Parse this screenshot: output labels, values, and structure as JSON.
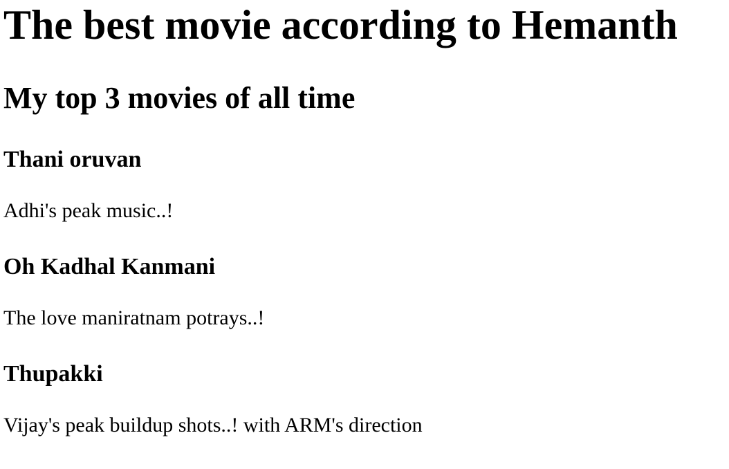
{
  "page": {
    "title": "The best movie according to Hemanth",
    "subtitle": "My top 3 movies of all time"
  },
  "movies": [
    {
      "title": "Thani oruvan",
      "description": "Adhi's peak music..!"
    },
    {
      "title": "Oh Kadhal Kanmani",
      "description": "The love maniratnam potrays..!"
    },
    {
      "title": "Thupakki",
      "description": "Vijay's peak buildup shots..! with ARM's direction"
    }
  ]
}
